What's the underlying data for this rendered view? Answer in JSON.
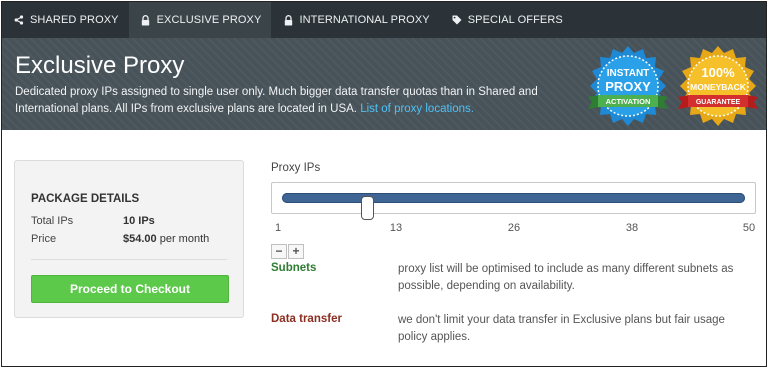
{
  "nav": {
    "items": [
      {
        "label": "SHARED PROXY",
        "icon": "share-icon",
        "active": false
      },
      {
        "label": "EXCLUSIVE PROXY",
        "icon": "lock-icon",
        "active": true
      },
      {
        "label": "INTERNATIONAL PROXY",
        "icon": "lock-icon",
        "active": false
      },
      {
        "label": "SPECIAL OFFERS",
        "icon": "tag-icon",
        "active": false
      }
    ]
  },
  "header": {
    "title": "Exclusive Proxy",
    "description": "Dedicated proxy IPs assigned to single user only. Much bigger data transfer quotas than in Shared and International plans. All IPs from exclusive plans are located in USA.",
    "link_text": "List of proxy locations."
  },
  "badges": {
    "instant": {
      "line1": "INSTANT",
      "line2": "PROXY",
      "ribbon": "ACTIVATION"
    },
    "guarantee": {
      "line1": "100%",
      "line2": "MONEYBACK",
      "ribbon": "GUARANTEE"
    }
  },
  "package": {
    "title": "PACKAGE DETAILS",
    "total_ips_label": "Total IPs",
    "total_ips_value": "10 IPs",
    "price_label": "Price",
    "price_value": "$54.00",
    "price_period": "per month",
    "checkout_label": "Proceed to Checkout"
  },
  "slider": {
    "label": "Proxy IPs",
    "min": 1,
    "max": 50,
    "value": 10,
    "ticks": [
      "1",
      "13",
      "26",
      "38",
      "50"
    ],
    "decrement": "−",
    "increment": "+"
  },
  "features": [
    {
      "title": "Subnets",
      "color": "#2e7d32",
      "desc": "proxy list will be optimised to include as many different subnets as possible, depending on availability."
    },
    {
      "title": "Data transfer",
      "color": "#8b2e22",
      "desc": "we don't limit your data transfer in Exclusive plans but fair usage policy applies."
    }
  ]
}
